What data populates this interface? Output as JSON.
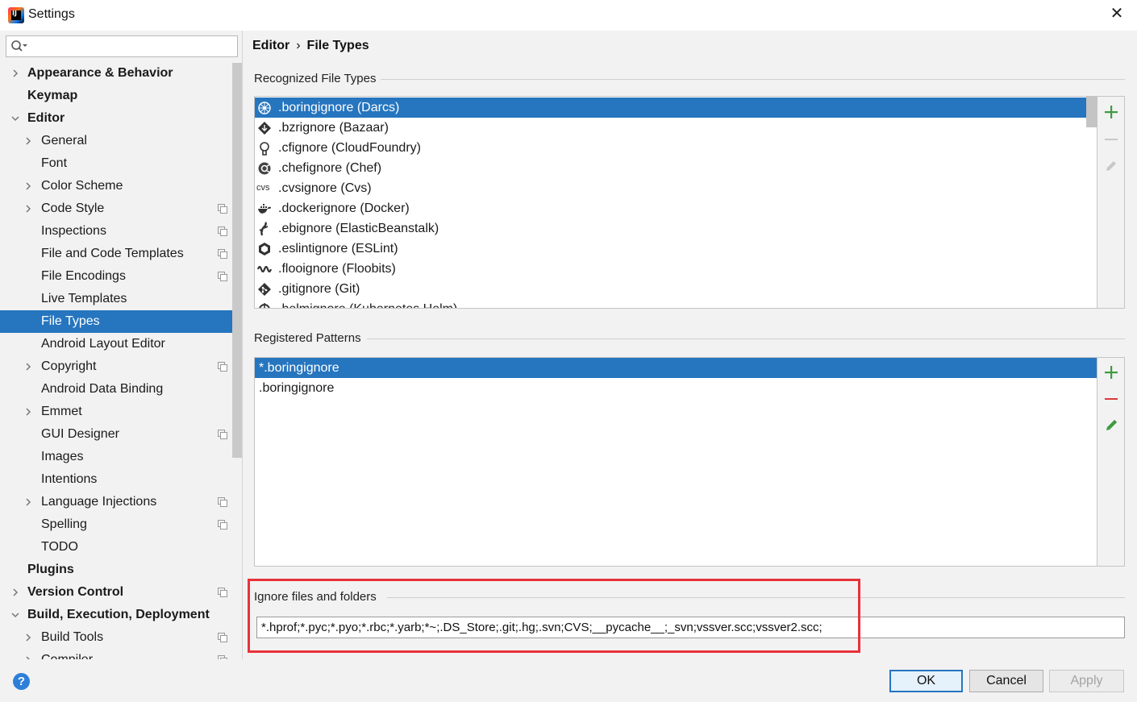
{
  "window": {
    "title": "Settings"
  },
  "sidebar": {
    "items": [
      {
        "label": "Appearance & Behavior",
        "level": 0,
        "bold": true,
        "arrow": "right"
      },
      {
        "label": "Keymap",
        "level": 0,
        "bold": true,
        "arrow": ""
      },
      {
        "label": "Editor",
        "level": 0,
        "bold": true,
        "arrow": "down"
      },
      {
        "label": "General",
        "level": 1,
        "arrow": "right"
      },
      {
        "label": "Font",
        "level": 1,
        "arrow": ""
      },
      {
        "label": "Color Scheme",
        "level": 1,
        "arrow": "right"
      },
      {
        "label": "Code Style",
        "level": 1,
        "arrow": "right",
        "project": true
      },
      {
        "label": "Inspections",
        "level": 1,
        "arrow": "",
        "project": true
      },
      {
        "label": "File and Code Templates",
        "level": 1,
        "arrow": "",
        "project": true
      },
      {
        "label": "File Encodings",
        "level": 1,
        "arrow": "",
        "project": true
      },
      {
        "label": "Live Templates",
        "level": 1,
        "arrow": ""
      },
      {
        "label": "File Types",
        "level": 1,
        "arrow": "",
        "selected": true
      },
      {
        "label": "Android Layout Editor",
        "level": 1,
        "arrow": ""
      },
      {
        "label": "Copyright",
        "level": 1,
        "arrow": "right",
        "project": true
      },
      {
        "label": "Android Data Binding",
        "level": 1,
        "arrow": ""
      },
      {
        "label": "Emmet",
        "level": 1,
        "arrow": "right"
      },
      {
        "label": "GUI Designer",
        "level": 1,
        "arrow": "",
        "project": true
      },
      {
        "label": "Images",
        "level": 1,
        "arrow": ""
      },
      {
        "label": "Intentions",
        "level": 1,
        "arrow": ""
      },
      {
        "label": "Language Injections",
        "level": 1,
        "arrow": "right",
        "project": true
      },
      {
        "label": "Spelling",
        "level": 1,
        "arrow": "",
        "project": true
      },
      {
        "label": "TODO",
        "level": 1,
        "arrow": ""
      },
      {
        "label": "Plugins",
        "level": 0,
        "bold": true,
        "arrow": ""
      },
      {
        "label": "Version Control",
        "level": 0,
        "bold": true,
        "arrow": "right",
        "project": true
      },
      {
        "label": "Build, Execution, Deployment",
        "level": 0,
        "bold": true,
        "arrow": "down"
      },
      {
        "label": "Build Tools",
        "level": 1,
        "arrow": "right",
        "project": true
      },
      {
        "label": "Compiler",
        "level": 1,
        "arrow": "right",
        "project": true
      }
    ]
  },
  "breadcrumb": {
    "parent": "Editor",
    "separator": "›",
    "current": "File Types"
  },
  "recognized": {
    "title": "Recognized File Types",
    "items": [
      {
        "name": ".boringignore (Darcs)",
        "icon": "darcs-icon",
        "selected": true
      },
      {
        "name": ".bzrignore (Bazaar)",
        "icon": "bazaar-icon"
      },
      {
        "name": ".cfignore (CloudFoundry)",
        "icon": "cloudfoundry-icon"
      },
      {
        "name": ".chefignore (Chef)",
        "icon": "chef-icon"
      },
      {
        "name": ".cvsignore (Cvs)",
        "icon": "cvs-icon",
        "icon_text": "cvs"
      },
      {
        "name": ".dockerignore (Docker)",
        "icon": "docker-icon"
      },
      {
        "name": ".ebignore (ElasticBeanstalk)",
        "icon": "elasticbeanstalk-icon"
      },
      {
        "name": ".eslintignore (ESLint)",
        "icon": "eslint-icon"
      },
      {
        "name": ".flooignore (Floobits)",
        "icon": "floobits-icon"
      },
      {
        "name": ".gitignore (Git)",
        "icon": "git-icon"
      },
      {
        "name": ".helmignore (Kubernetes Helm)",
        "icon": "helm-icon"
      }
    ]
  },
  "patterns": {
    "title": "Registered Patterns",
    "items": [
      {
        "value": "*.boringignore",
        "selected": true
      },
      {
        "value": ".boringignore"
      }
    ]
  },
  "ignore": {
    "title": "Ignore files and folders",
    "value": "*.hprof;*.pyc;*.pyo;*.rbc;*.yarb;*~;.DS_Store;.git;.hg;.svn;CVS;__pycache__;_svn;vssver.scc;vssver2.scc;"
  },
  "footer": {
    "help": "?",
    "ok": "OK",
    "cancel": "Cancel",
    "apply": "Apply"
  },
  "colors": {
    "selection": "#2675bf",
    "add": "#3f9c3f",
    "remove": "#d93b3b",
    "highlight": "#e8323a"
  }
}
